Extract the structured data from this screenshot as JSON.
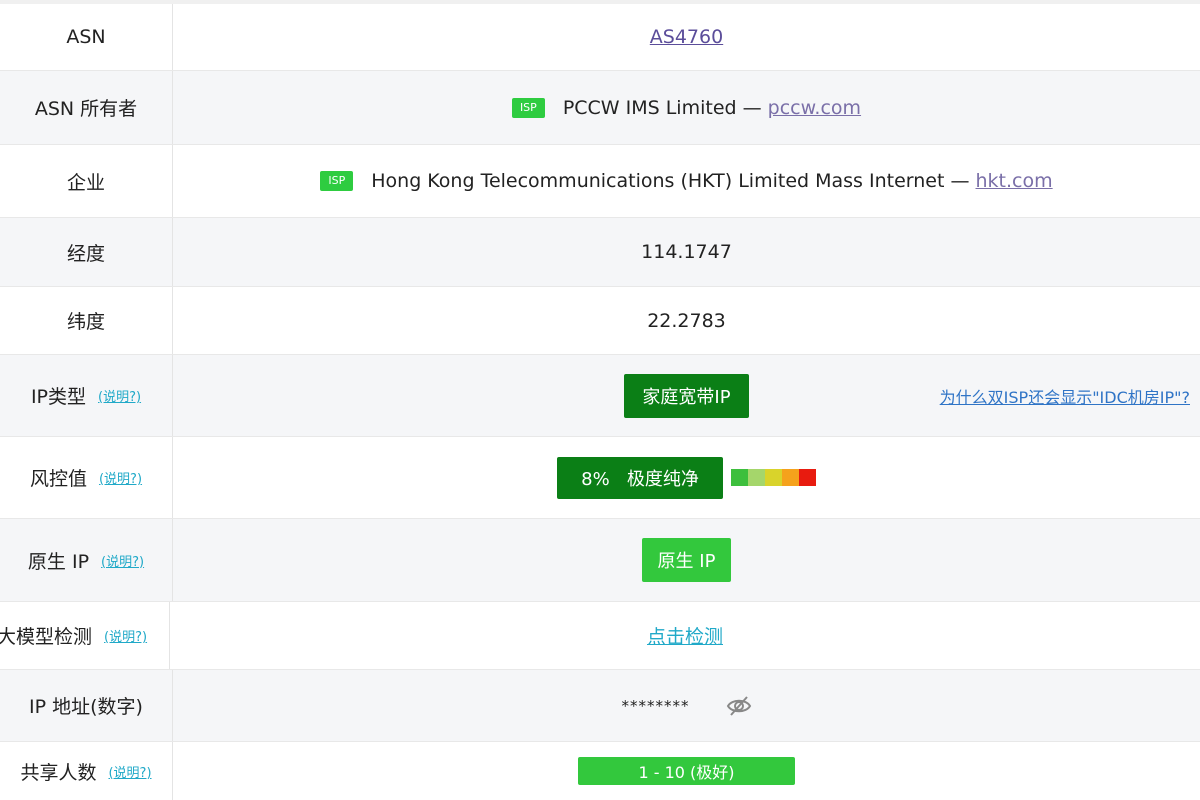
{
  "rows": {
    "asn": {
      "label": "ASN",
      "value": "AS4760"
    },
    "asn_owner": {
      "label": "ASN 所有者",
      "badge": "ISP",
      "name": "PCCW IMS Limited —",
      "domain": "pccw.com"
    },
    "company": {
      "label": "企业",
      "badge": "ISP",
      "name": "Hong Kong Telecommunications (HKT) Limited Mass Internet —",
      "domain": "hkt.com"
    },
    "longitude": {
      "label": "经度",
      "value": "114.1747"
    },
    "latitude": {
      "label": "纬度",
      "value": "22.2783"
    },
    "ip_type": {
      "label": "IP类型",
      "help": "(说明?)",
      "value": "家庭宽带IP",
      "side_link": "为什么双ISP还会显示\"IDC机房IP\"?"
    },
    "risk": {
      "label": "风控值",
      "help": "(说明?)",
      "value": "8%   极度纯净",
      "scale_colors": [
        "#3dbf3d",
        "#a5d66b",
        "#d9d32b",
        "#f5a21c",
        "#e81b0f"
      ]
    },
    "native_ip": {
      "label": "原生 IP",
      "help": "(说明?)",
      "value": "原生 IP"
    },
    "llm_detect": {
      "label": "大模型检测",
      "help": "(说明?)",
      "value": "点击检测"
    },
    "ip_numeric": {
      "label": "IP 地址(数字)",
      "value": "********"
    },
    "shared_users": {
      "label": "共享人数",
      "help": "(说明?)",
      "value": "1 - 10 (极好)"
    }
  },
  "colors": {
    "dark_green": "#0b7f16",
    "light_green": "#33c83d",
    "isp_badge": "#2ecc40",
    "help_link": "#20a9c8",
    "side_link": "#2f74c6"
  },
  "icons": {
    "toggle_visibility": "eye-slash-icon"
  }
}
